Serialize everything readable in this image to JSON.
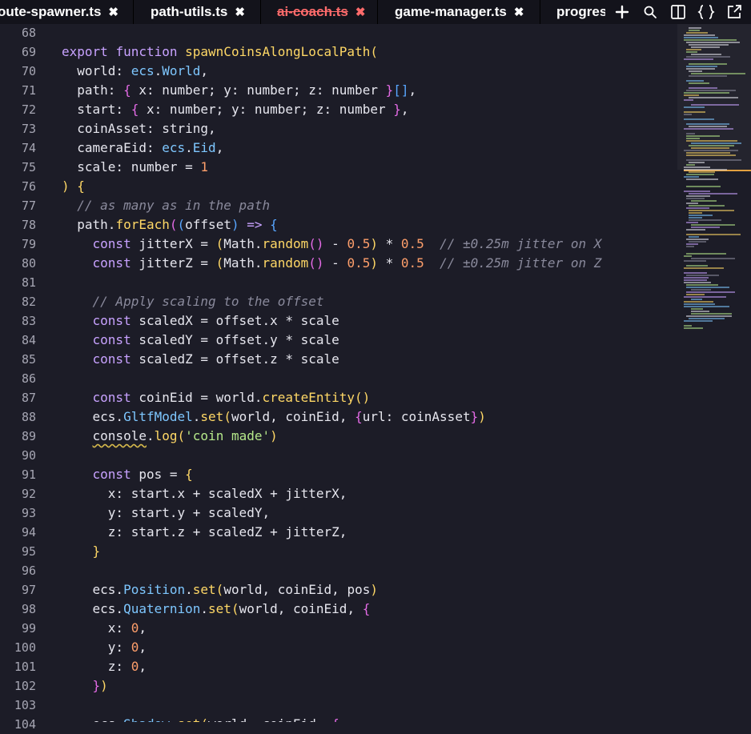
{
  "tabs": [
    {
      "label": "oute-spawner.ts",
      "close": "✖",
      "state": "normal"
    },
    {
      "label": "path-utils.ts",
      "close": "✖",
      "state": "normal"
    },
    {
      "label": "ai-coach.ts",
      "close": "✖",
      "state": "deleted"
    },
    {
      "label": "game-manager.ts",
      "close": "✖",
      "state": "normal"
    },
    {
      "label": "progres",
      "close": "",
      "state": "normal"
    }
  ],
  "actions": {
    "add": "add-icon",
    "search": "search-icon",
    "split": "split-editor-icon",
    "braces": "format-braces-icon",
    "external": "open-external-icon"
  },
  "colors": {
    "background": "#1c1c27",
    "tabbar": "#13131b",
    "keyword": "#c8a2ff",
    "function": "#ffd866",
    "type": "#7ec7ff",
    "number": "#ff9f6b",
    "string": "#b5e88a",
    "comment": "#8a8a9c",
    "deleted_tab": "#ff6b6b",
    "minimap_marker": "#e2a03f"
  },
  "editor": {
    "lines": [
      {
        "n": "68",
        "segs": []
      },
      {
        "n": "69",
        "segs": [
          [
            "kw",
            "export "
          ],
          [
            "kw",
            "function "
          ],
          [
            "fn",
            "spawnCoinsAlongLocalPath"
          ],
          [
            "p1",
            "("
          ]
        ]
      },
      {
        "n": "70",
        "segs": [
          [
            "",
            "  world: "
          ],
          [
            "ty",
            "ecs"
          ],
          [
            "",
            "."
          ],
          [
            "ty",
            "World"
          ],
          [
            "",
            ","
          ]
        ]
      },
      {
        "n": "71",
        "segs": [
          [
            "",
            "  path: "
          ],
          [
            "p2",
            "{"
          ],
          [
            "",
            " x: number; y: number; z: number "
          ],
          [
            "p2",
            "}"
          ],
          [
            "p3",
            "[]"
          ],
          [
            "",
            ","
          ]
        ]
      },
      {
        "n": "72",
        "segs": [
          [
            "",
            "  start: "
          ],
          [
            "p2",
            "{"
          ],
          [
            "",
            " x: number; y: number; z: number "
          ],
          [
            "p2",
            "}"
          ],
          [
            "",
            ","
          ]
        ]
      },
      {
        "n": "73",
        "segs": [
          [
            "",
            "  coinAsset: string,"
          ]
        ]
      },
      {
        "n": "74",
        "segs": [
          [
            "",
            "  cameraEid: "
          ],
          [
            "ty",
            "ecs"
          ],
          [
            "",
            "."
          ],
          [
            "ty",
            "Eid"
          ],
          [
            "",
            ","
          ]
        ]
      },
      {
        "n": "75",
        "segs": [
          [
            "",
            "  scale: number = "
          ],
          [
            "num",
            "1"
          ]
        ]
      },
      {
        "n": "76",
        "segs": [
          [
            "p1",
            ")"
          ],
          [
            "",
            " "
          ],
          [
            "p1",
            "{"
          ]
        ]
      },
      {
        "n": "77",
        "segs": [
          [
            "com",
            "  // as many as in the path"
          ]
        ]
      },
      {
        "n": "78",
        "segs": [
          [
            "",
            "  path."
          ],
          [
            "fn",
            "forEach"
          ],
          [
            "p2",
            "("
          ],
          [
            "p3",
            "("
          ],
          [
            "",
            "offset"
          ],
          [
            "p3",
            ")"
          ],
          [
            "",
            " "
          ],
          [
            "kw",
            "=>"
          ],
          [
            "",
            " "
          ],
          [
            "p3",
            "{"
          ]
        ]
      },
      {
        "n": "79",
        "segs": [
          [
            "",
            "    "
          ],
          [
            "kw",
            "const "
          ],
          [
            "",
            "jitterX = "
          ],
          [
            "p1",
            "("
          ],
          [
            "",
            "Math."
          ],
          [
            "fn",
            "random"
          ],
          [
            "p2",
            "()"
          ],
          [
            "",
            " - "
          ],
          [
            "num",
            "0.5"
          ],
          [
            "p1",
            ")"
          ],
          [
            "",
            " * "
          ],
          [
            "num",
            "0.5"
          ],
          [
            "com",
            "  // ±0.25m jitter on X"
          ]
        ]
      },
      {
        "n": "80",
        "segs": [
          [
            "",
            "    "
          ],
          [
            "kw",
            "const "
          ],
          [
            "",
            "jitterZ = "
          ],
          [
            "p1",
            "("
          ],
          [
            "",
            "Math."
          ],
          [
            "fn",
            "random"
          ],
          [
            "p2",
            "()"
          ],
          [
            "",
            " - "
          ],
          [
            "num",
            "0.5"
          ],
          [
            "p1",
            ")"
          ],
          [
            "",
            " * "
          ],
          [
            "num",
            "0.5"
          ],
          [
            "com",
            "  // ±0.25m jitter on Z"
          ]
        ]
      },
      {
        "n": "81",
        "segs": []
      },
      {
        "n": "82",
        "segs": [
          [
            "com",
            "    // Apply scaling to the offset"
          ]
        ]
      },
      {
        "n": "83",
        "segs": [
          [
            "",
            "    "
          ],
          [
            "kw",
            "const "
          ],
          [
            "",
            "scaledX = offset.x * scale"
          ]
        ]
      },
      {
        "n": "84",
        "segs": [
          [
            "",
            "    "
          ],
          [
            "kw",
            "const "
          ],
          [
            "",
            "scaledY = offset.y * scale"
          ]
        ]
      },
      {
        "n": "85",
        "segs": [
          [
            "",
            "    "
          ],
          [
            "kw",
            "const "
          ],
          [
            "",
            "scaledZ = offset.z * scale"
          ]
        ]
      },
      {
        "n": "86",
        "segs": []
      },
      {
        "n": "87",
        "segs": [
          [
            "",
            "    "
          ],
          [
            "kw",
            "const "
          ],
          [
            "",
            "coinEid = world."
          ],
          [
            "fn",
            "createEntity"
          ],
          [
            "p1",
            "()"
          ]
        ]
      },
      {
        "n": "88",
        "segs": [
          [
            "",
            "    ecs."
          ],
          [
            "ty",
            "GltfModel"
          ],
          [
            "",
            "."
          ],
          [
            "fn",
            "set"
          ],
          [
            "p1",
            "("
          ],
          [
            "",
            "world, coinEid, "
          ],
          [
            "p2",
            "{"
          ],
          [
            "",
            "url: coinAsset"
          ],
          [
            "p2",
            "}"
          ],
          [
            "p1",
            ")"
          ]
        ]
      },
      {
        "n": "89",
        "segs": [
          [
            "",
            "    "
          ],
          [
            "warn",
            "console"
          ],
          [
            "",
            "."
          ],
          [
            "fn",
            "log"
          ],
          [
            "p1",
            "("
          ],
          [
            "str",
            "'coin made'"
          ],
          [
            "p1",
            ")"
          ]
        ]
      },
      {
        "n": "90",
        "segs": []
      },
      {
        "n": "91",
        "segs": [
          [
            "",
            "    "
          ],
          [
            "kw",
            "const "
          ],
          [
            "",
            "pos = "
          ],
          [
            "p1",
            "{"
          ]
        ]
      },
      {
        "n": "92",
        "segs": [
          [
            "",
            "      x: start.x + scaledX + jitterX,"
          ]
        ]
      },
      {
        "n": "93",
        "segs": [
          [
            "",
            "      y: start.y + scaledY,"
          ]
        ]
      },
      {
        "n": "94",
        "segs": [
          [
            "",
            "      z: start.z + scaledZ + jitterZ,"
          ]
        ]
      },
      {
        "n": "95",
        "segs": [
          [
            "",
            "    "
          ],
          [
            "p1",
            "}"
          ]
        ]
      },
      {
        "n": "96",
        "segs": []
      },
      {
        "n": "97",
        "segs": [
          [
            "",
            "    ecs."
          ],
          [
            "ty",
            "Position"
          ],
          [
            "",
            "."
          ],
          [
            "fn",
            "set"
          ],
          [
            "p1",
            "("
          ],
          [
            "",
            "world, coinEid, pos"
          ],
          [
            "p1",
            ")"
          ]
        ]
      },
      {
        "n": "98",
        "segs": [
          [
            "",
            "    ecs."
          ],
          [
            "ty",
            "Quaternion"
          ],
          [
            "",
            "."
          ],
          [
            "fn",
            "set"
          ],
          [
            "p1",
            "("
          ],
          [
            "",
            "world, coinEid, "
          ],
          [
            "p2",
            "{"
          ]
        ]
      },
      {
        "n": "99",
        "segs": [
          [
            "",
            "      x: "
          ],
          [
            "num",
            "0"
          ],
          [
            "",
            ","
          ]
        ]
      },
      {
        "n": "100",
        "segs": [
          [
            "",
            "      y: "
          ],
          [
            "num",
            "0"
          ],
          [
            "",
            ","
          ]
        ]
      },
      {
        "n": "101",
        "segs": [
          [
            "",
            "      z: "
          ],
          [
            "num",
            "0"
          ],
          [
            "",
            ","
          ]
        ]
      },
      {
        "n": "102",
        "segs": [
          [
            "",
            "    "
          ],
          [
            "p2",
            "}"
          ],
          [
            "p1",
            ")"
          ]
        ]
      },
      {
        "n": "103",
        "segs": []
      },
      {
        "n": "104",
        "segs": [
          [
            "",
            "    ecs."
          ],
          [
            "ty",
            "Shadow"
          ],
          [
            "",
            "."
          ],
          [
            "fn",
            "set"
          ],
          [
            "p1",
            "("
          ],
          [
            "",
            "world, coinEid, "
          ],
          [
            "p2",
            "{"
          ]
        ]
      }
    ]
  }
}
